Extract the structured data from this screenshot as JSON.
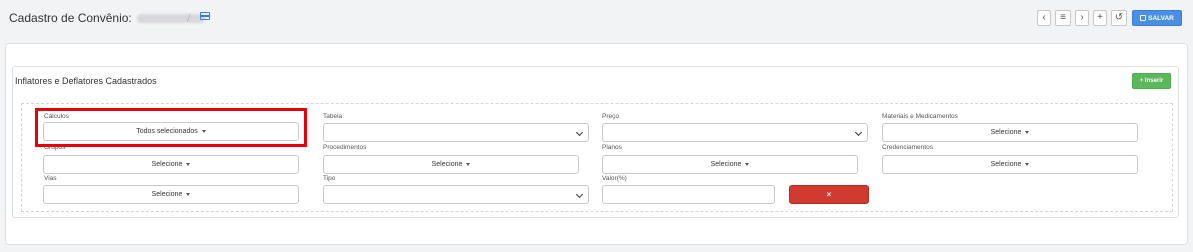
{
  "header": {
    "title": "Cadastro de Convênio:",
    "buttons": {
      "prev": "‹",
      "list": "≡",
      "next": "›",
      "add": "+",
      "history": "↺",
      "save": "SALVAR"
    }
  },
  "panel": {
    "title": "Inflatores e Deflatores Cadastrados",
    "insert_label": "+ Inserir"
  },
  "filters": {
    "calculos": {
      "label": "Cálculos",
      "value": "Todos selecionados"
    },
    "tabela": {
      "label": "Tabela",
      "value": ""
    },
    "preco": {
      "label": "Preço",
      "value": ""
    },
    "materiais": {
      "label": "Materiais e Medicamentos",
      "value": "Selecione"
    },
    "grupos": {
      "label": "Grupos",
      "value": "Selecione"
    },
    "procedimentos": {
      "label": "Procedimentos",
      "value": "Selecione"
    },
    "planos": {
      "label": "Planos",
      "value": "Selecione"
    },
    "credenciamentos": {
      "label": "Credenciamentos",
      "value": "Selecione"
    },
    "vias": {
      "label": "Vias",
      "value": "Selecione"
    },
    "tipo": {
      "label": "Tipo",
      "value": ""
    },
    "valor": {
      "label": "Valor(%)",
      "value": ""
    },
    "remove_label": "×"
  },
  "colors": {
    "primary": "#4a90e2",
    "success": "#5cb85c",
    "danger": "#d03a2f",
    "highlight": "#e8000b"
  }
}
